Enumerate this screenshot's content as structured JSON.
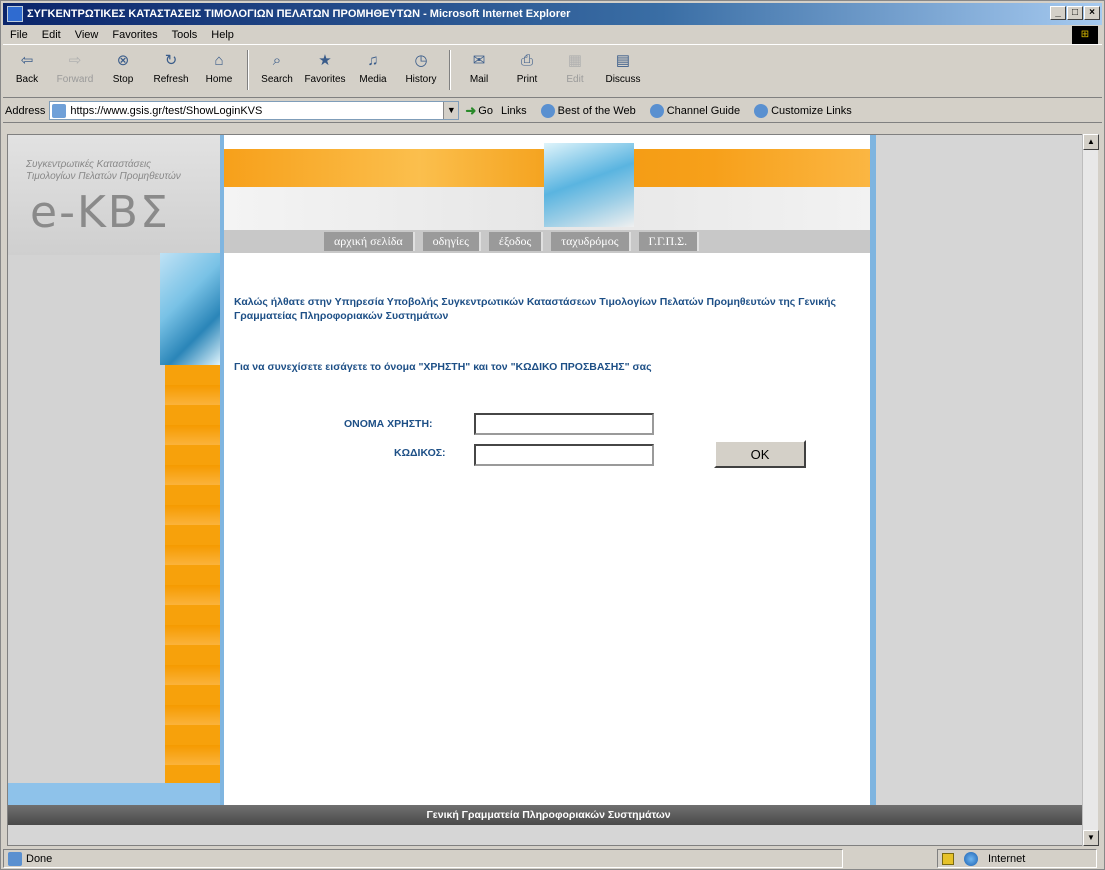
{
  "window": {
    "title": "ΣΥΓΚΕΝΤΡΩΤΙΚΕΣ ΚΑΤΑΣΤΑΣΕΙΣ ΤΙΜΟΛΟΓΙΩΝ ΠΕΛΑΤΩΝ ΠΡΟΜΗΘΕΥΤΩΝ - Microsoft Internet Explorer",
    "minimize": "_",
    "maximize": "□",
    "close": "×"
  },
  "menu": {
    "items": [
      "File",
      "Edit",
      "View",
      "Favorites",
      "Tools",
      "Help"
    ]
  },
  "toolbar": {
    "back": "Back",
    "forward": "Forward",
    "stop": "Stop",
    "refresh": "Refresh",
    "home": "Home",
    "search": "Search",
    "favorites": "Favorites",
    "media": "Media",
    "history": "History",
    "mail": "Mail",
    "print": "Print",
    "edit": "Edit",
    "discuss": "Discuss"
  },
  "address": {
    "label": "Address",
    "url": "https://www.gsis.gr/test/ShowLoginKVS",
    "go": "Go",
    "links_label": "Links",
    "links": [
      "Best of the Web",
      "Channel Guide",
      "Customize Links"
    ]
  },
  "page": {
    "logo_small_1": "Συγκεντρωτικές Καταστάσεις",
    "logo_small_2": "Τιμολογίων Πελατών Προμηθευτών",
    "logo_main": "e-ΚΒΣ",
    "nav": [
      "αρχική σελίδα",
      "οδηγίες",
      "έξοδος",
      "ταχυδρόμος",
      "Γ.Γ.Π.Σ."
    ],
    "welcome": "Καλώς ήλθατε στην Υπηρεσία Υποβολής Συγκεντρωτικών Καταστάσεων Τιμολογίων Πελατών Προμηθευτών της Γενικής Γραμματείας Πληροφοριακών Συστημάτων",
    "instruction": "Για να συνεχίσετε εισάγετε το όνομα \"ΧΡΗΣΤΗ\" και τον \"ΚΩΔΙΚΟ ΠΡΟΣΒΑΣΗΣ\" σας",
    "username_label": "ΟΝΟΜΑ ΧΡΗΣΤΗ:",
    "password_label": "ΚΩΔΙΚΟΣ:",
    "username_value": "",
    "password_value": "",
    "ok_button": "OK",
    "footer": "Γενική Γραμματεία Πληροφοριακών Συστημάτων"
  },
  "status": {
    "text": "Done",
    "zone": "Internet"
  }
}
